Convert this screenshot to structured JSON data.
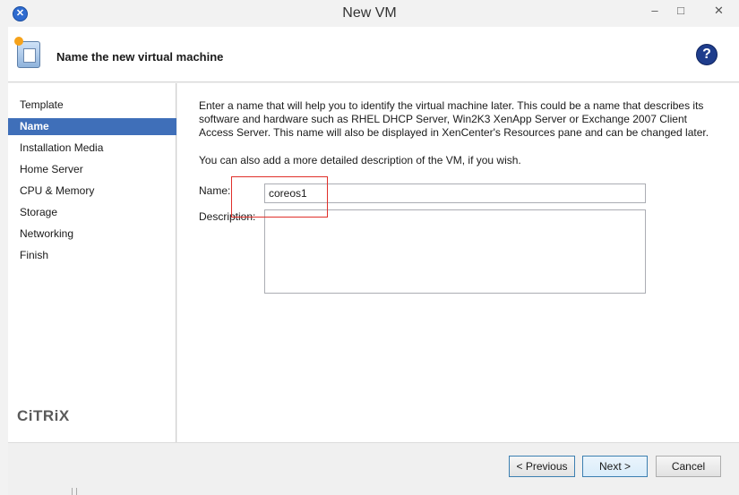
{
  "window": {
    "title": "New VM"
  },
  "header": {
    "title": "Name the new virtual machine",
    "help_icon": "?"
  },
  "sidebar": {
    "items": [
      {
        "label": "Template"
      },
      {
        "label": "Name"
      },
      {
        "label": "Installation Media"
      },
      {
        "label": "Home Server"
      },
      {
        "label": "CPU & Memory"
      },
      {
        "label": "Storage"
      },
      {
        "label": "Networking"
      },
      {
        "label": "Finish"
      }
    ],
    "active_index": 1,
    "logo": "CiTRiX"
  },
  "main": {
    "intro": "Enter a name that will help you to identify the virtual machine later. This could be a name that describes its software and hardware such as RHEL DHCP Server, Win2K3 XenApp Server or Exchange 2007 Client Access Server. This name will also be displayed in XenCenter's Resources pane and can be changed later.",
    "intro2": "You can also add a more detailed description of the VM, if you wish.",
    "name_label": "Name:",
    "name_value": "coreos1",
    "description_label": "Description:",
    "description_value": ""
  },
  "footer": {
    "previous": "< Previous",
    "next": "Next >",
    "cancel": "Cancel"
  },
  "colors": {
    "active_nav": "#3f6fb9",
    "highlight_box": "#e0302a"
  }
}
